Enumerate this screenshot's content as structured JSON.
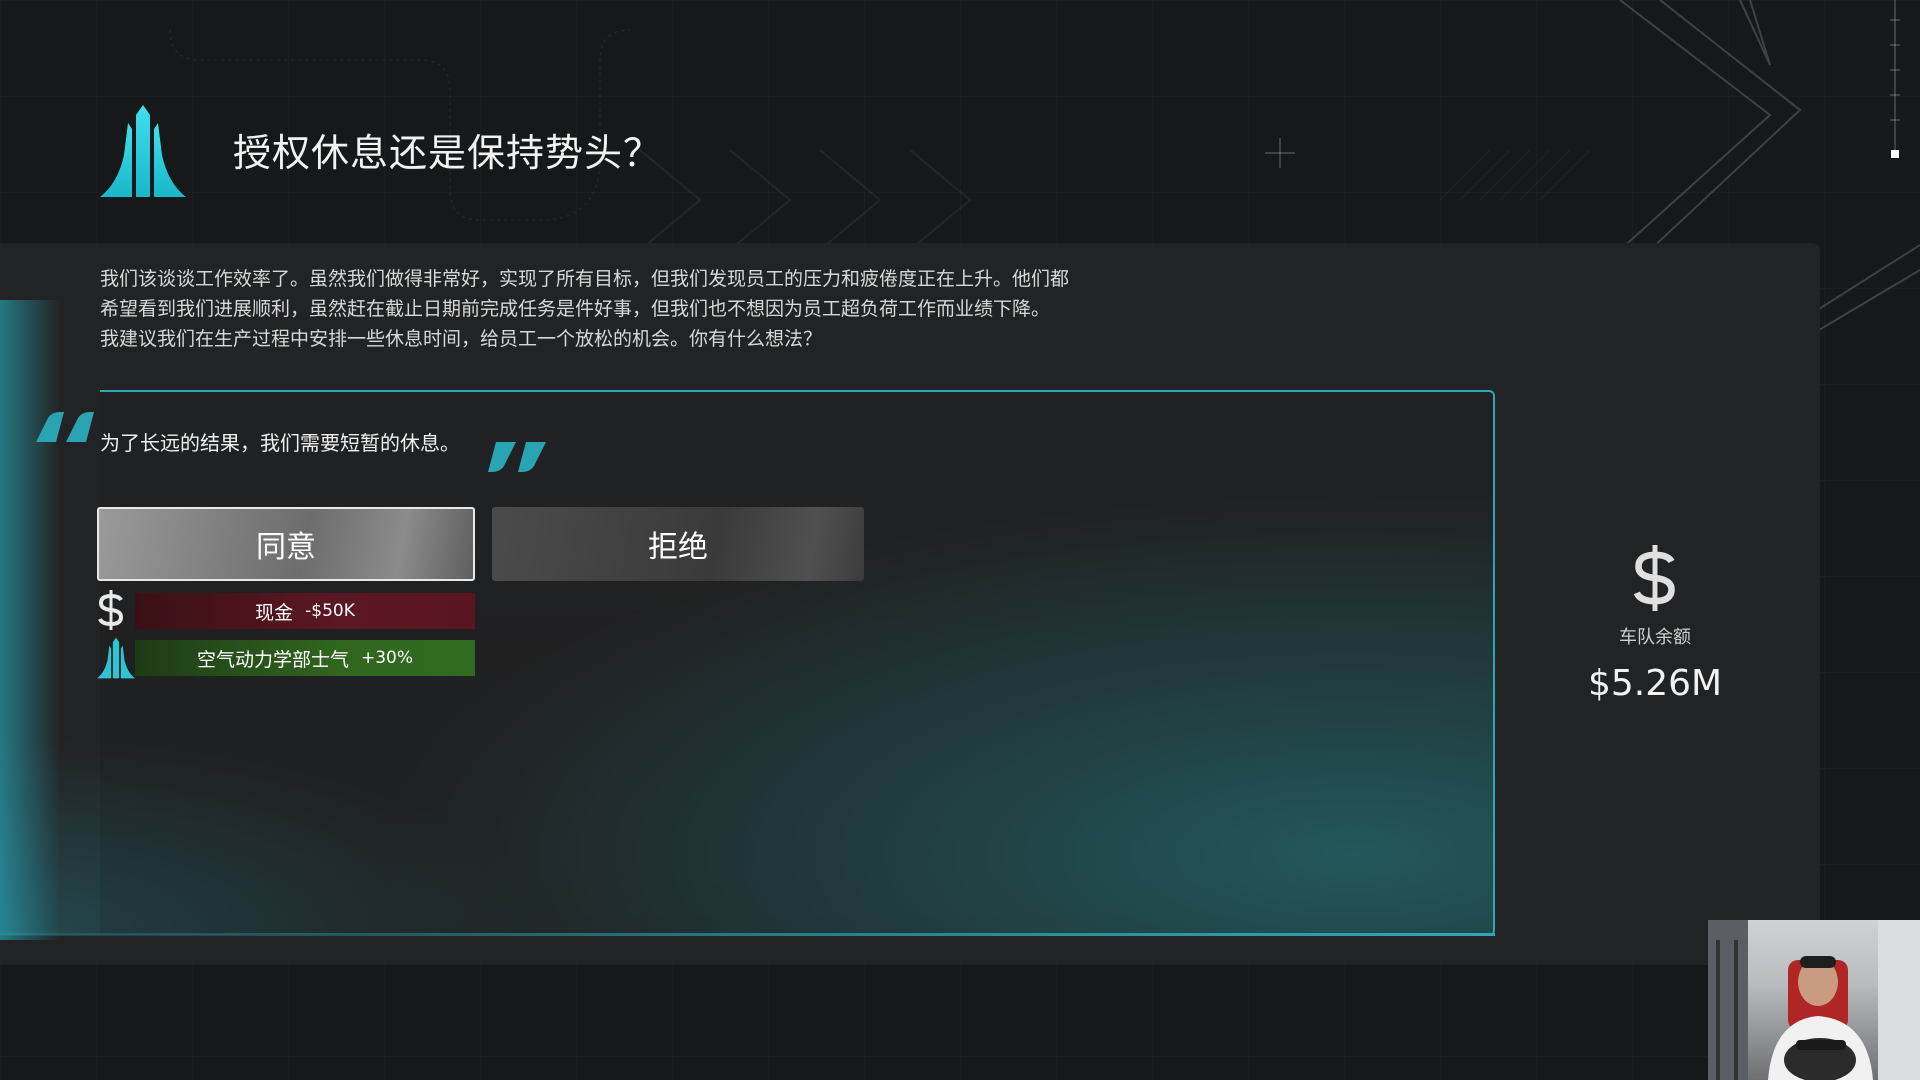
{
  "event": {
    "title": "授权休息还是保持势头？",
    "description": [
      "我们该谈谈工作效率了。虽然我们做得非常好，实现了所有目标，但我们发现员工的压力和疲倦度正在上升。他们都",
      "希望看到我们进展顺利，虽然赶在截止日期前完成任务是件好事，但我们也不想因为员工超负荷工作而业绩下降。",
      "我建议我们在生产过程中安排一些休息时间，给员工一个放松的机会。你有什么想法？"
    ],
    "quote": "为了长远的结果，我们需要短暂的休息。"
  },
  "buttons": {
    "agree": "同意",
    "refuse": "拒绝"
  },
  "effects": {
    "cash_label": "现金",
    "cash_value": "-$50K",
    "morale_label": "空气动力学部士气",
    "morale_value": "+30%"
  },
  "balance": {
    "label": "车队余额",
    "value": "$5.26M"
  },
  "colors": {
    "accent": "#2ea7b7",
    "negative": "#5c1724",
    "positive": "#31661f"
  },
  "icons": {
    "department": "aero-department-icon",
    "currency": "dollar-icon"
  }
}
